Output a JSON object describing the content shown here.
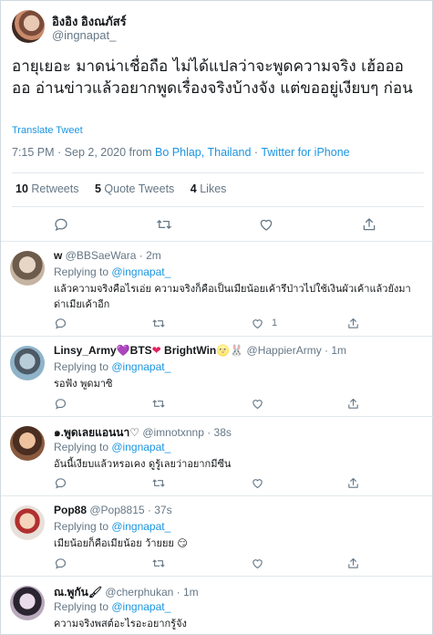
{
  "tweet": {
    "display_name": "อิงอิง อิงณภัสร์",
    "handle": "@ingnapat_",
    "text": "อายุเยอะ มาดน่าเชื่อถือ ไม่ได้แปลว่าจะพูดความจริง เฮ้อออ ออ อ่านข่าวแล้วอยากพูดเรื่องจริงบ้างจัง แต่ขออยู่เงียบๆ ก่อน",
    "translate_label": "Translate Tweet",
    "time": "7:15 PM · Sep 2, 2020 from ",
    "location": "Bo Phlap, Thailand",
    "separator": " · ",
    "client": "Twitter for iPhone",
    "retweets_count": "10",
    "retweets_label": " Retweets",
    "quotes_count": "5",
    "quotes_label": " Quote Tweets",
    "likes_count": "4",
    "likes_label": " Likes"
  },
  "replies": [
    {
      "name": "w",
      "handle": " @BBSaeWara · 2m",
      "replying_prefix": "Replying to ",
      "replying_handle": "@ingnapat_",
      "text": "แล้วความจริงคือไรเอ่ย ความจริงก็คือเป็นเมียน้อยเค้ารึป่าวไปใช้เงินผัวเค้าแล้วยังมาด่าเมียเค้าอีก",
      "like_count": "1",
      "avatar_colors": [
        "#d9c8b8",
        "#7a6a5a"
      ]
    },
    {
      "name": "Linsy_Army",
      "name_suffix1": "💜",
      "name_mid": "BTS",
      "name_suffix2": "❤",
      "name_tail": " BrightWin",
      "name_emoji3": "🌝",
      "name_emoji4": "🐰",
      "handle": " @HappierArmy · 1m",
      "replying_prefix": "Replying to ",
      "replying_handle": "@ingnapat_",
      "text": "รอฟัง พูดมาซิ",
      "like_count": "",
      "avatar_colors": [
        "#8fb3c9",
        "#3d4a56"
      ]
    },
    {
      "name": "๑.พูดเลยแอนนา♡",
      "handle": " @imnotxnnp · 38s",
      "replying_prefix": "Replying to ",
      "replying_handle": "@ingnapat_",
      "text": "อันนี้เงียบแล้วหรอเคง ดูรู้เลยว่าอยากมีซีน",
      "like_count": "",
      "avatar_colors": [
        "#e3b08a",
        "#4a2e22"
      ]
    },
    {
      "name": "Pop88",
      "handle": " @Pop8815 · 37s",
      "replying_prefix": "Replying to ",
      "replying_handle": "@ingnapat_",
      "text": "เมียน้อยก็คือเมียน้อย ว้ายยย",
      "text_emoji": " 😏",
      "like_count": "",
      "avatar_colors": [
        "#f0c9b0",
        "#b0302e"
      ]
    },
    {
      "name": "ณ.พูกัน",
      "name_emoji": "🖌",
      "handle": " @cherphukan · 1m",
      "replying_prefix": "Replying to ",
      "replying_handle": "@ingnapat_",
      "text": "ความจริงพสต์อะไรอะอยากรู้จัง",
      "like_count": "",
      "avatar_colors": [
        "#d7c7d9",
        "#2a2330"
      ]
    }
  ],
  "colors": {
    "link": "#1b95e0",
    "secondary": "#657786",
    "text": "#14171a",
    "border": "#e1e8ed"
  }
}
